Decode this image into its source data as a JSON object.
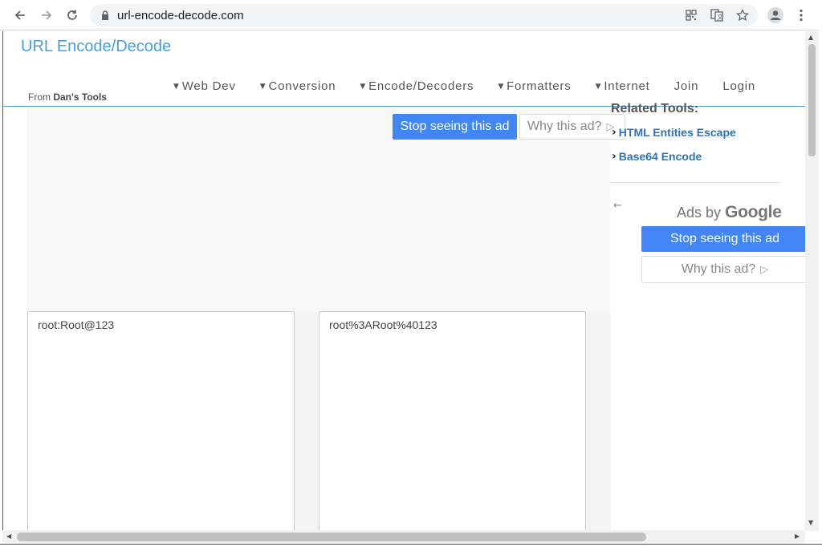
{
  "browser": {
    "url": "url-encode-decode.com",
    "icons": [
      "back-icon",
      "forward-icon",
      "reload-icon",
      "lock-icon",
      "qr-icon",
      "translate-icon",
      "star-icon",
      "profile-icon",
      "menu-icon"
    ]
  },
  "site": {
    "title": "URL Encode/Decode",
    "from_prefix": "From",
    "from_name": "Dan's Tools"
  },
  "nav": {
    "items": [
      {
        "label": "Web Dev",
        "dropdown": true
      },
      {
        "label": "Conversion",
        "dropdown": true
      },
      {
        "label": "Encode/Decoders",
        "dropdown": true
      },
      {
        "label": "Formatters",
        "dropdown": true
      },
      {
        "label": "Internet",
        "dropdown": true
      },
      {
        "label": "Join",
        "dropdown": false
      },
      {
        "label": "Login",
        "dropdown": false
      }
    ]
  },
  "ad_top": {
    "stop_label": "Stop seeing this ad",
    "why_label": "Why this ad?"
  },
  "related": {
    "title": "Related Tools:",
    "items": [
      "HTML Entities Escape",
      "Base64 Encode"
    ]
  },
  "ad_side": {
    "ads_by": "Ads by",
    "google": "Google",
    "stop_label": "Stop seeing this ad",
    "why_label": "Why this ad?"
  },
  "editor": {
    "input_value": "root:Root@123",
    "output_value": "root%3ARoot%40123"
  },
  "colors": {
    "accent": "#4a9fd5",
    "link": "#2a74b8",
    "ad_button": "#4285f4"
  }
}
